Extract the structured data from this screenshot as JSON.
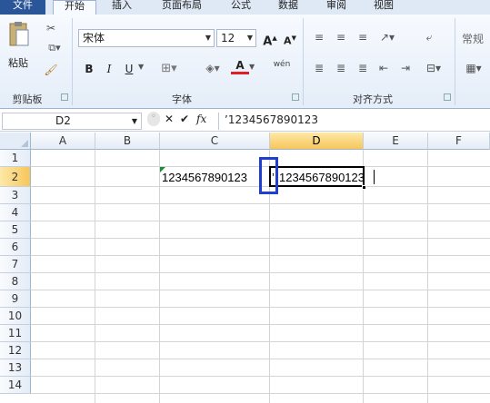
{
  "tabs": [
    "文件",
    "开始",
    "插入",
    "页面布局",
    "公式",
    "数据",
    "审阅",
    "视图"
  ],
  "clipboard": {
    "paste_label": "粘贴",
    "group_label": "剪贴板"
  },
  "font": {
    "name": "宋体",
    "size": "12",
    "bold": "B",
    "italic": "I",
    "underline": "U",
    "font_color_label": "A",
    "phonetic": "wén",
    "group_label": "字体"
  },
  "alignment": {
    "group_label": "对齐方式"
  },
  "number": {
    "format": "常规"
  },
  "formula_bar": {
    "name_box": "D2",
    "fx": "fx",
    "formula": "’1234567890123"
  },
  "grid": {
    "columns": [
      "A",
      "B",
      "C",
      "D",
      "E",
      "F"
    ],
    "selected_column": "D",
    "rows": [
      "1",
      "2",
      "3",
      "4",
      "5",
      "6",
      "7",
      "8",
      "9",
      "10",
      "11",
      "12",
      "13",
      "14"
    ],
    "selected_row": "2",
    "cells": {
      "C2": "1234567890123",
      "D2_quote": "’",
      "D2": "1234567890123"
    }
  },
  "colors": {
    "accent": "#2a5699",
    "highlight": "#1f3fd1",
    "font_color": "#e02020"
  }
}
